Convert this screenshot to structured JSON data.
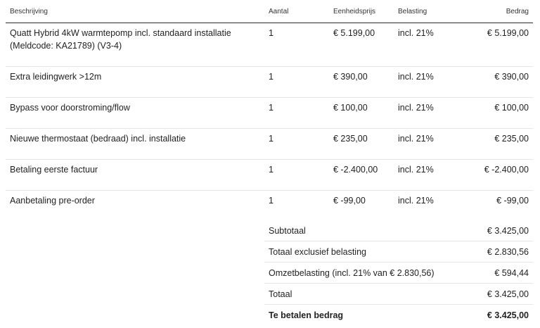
{
  "table": {
    "headers": {
      "description": "Beschrijving",
      "quantity": "Aantal",
      "unit_price": "Eenheidsprijs",
      "tax": "Belasting",
      "amount": "Bedrag"
    },
    "rows": [
      {
        "description": "Quatt Hybrid 4kW warmtepomp incl. standaard installatie (Meldcode: KA21789) (V3-4)",
        "quantity": "1",
        "unit_price": "€ 5.199,00",
        "tax": "incl. 21%",
        "amount": "€ 5.199,00"
      },
      {
        "description": "Extra leidingwerk >12m",
        "quantity": "1",
        "unit_price": "€ 390,00",
        "tax": "incl. 21%",
        "amount": "€ 390,00"
      },
      {
        "description": "Bypass voor doorstroming/flow",
        "quantity": "1",
        "unit_price": "€ 100,00",
        "tax": "incl. 21%",
        "amount": "€ 100,00"
      },
      {
        "description": "Nieuwe thermostaat (bedraad) incl. installatie",
        "quantity": "1",
        "unit_price": "€ 235,00",
        "tax": "incl. 21%",
        "amount": "€ 235,00"
      },
      {
        "description": "Betaling eerste factuur",
        "quantity": "1",
        "unit_price": "€ -2.400,00",
        "tax": "incl. 21%",
        "amount": "€ -2.400,00"
      },
      {
        "description": "Aanbetaling pre-order",
        "quantity": "1",
        "unit_price": "€ -99,00",
        "tax": "incl. 21%",
        "amount": "€ -99,00"
      }
    ]
  },
  "totals": [
    {
      "label": "Subtotaal",
      "value": "€ 3.425,00"
    },
    {
      "label": "Totaal exclusief belasting",
      "value": "€ 2.830,56"
    },
    {
      "label": "Omzetbelasting (incl. 21% van € 2.830,56)",
      "value": "€ 594,44"
    },
    {
      "label": "Totaal",
      "value": "€ 3.425,00"
    },
    {
      "label": "Te betalen bedrag",
      "value": "€ 3.425,00"
    }
  ]
}
